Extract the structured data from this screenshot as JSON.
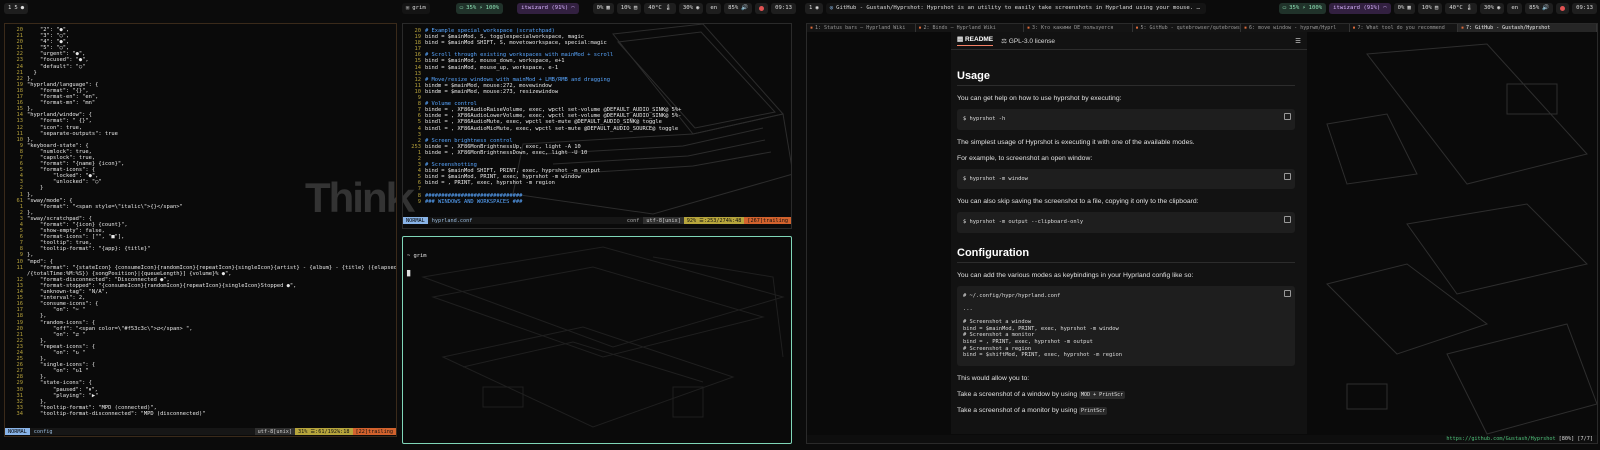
{
  "bar_left": {
    "workspace_badge": "1",
    "workspace_items": [
      "5",
      "●"
    ],
    "app_label": "grim",
    "tiles": [
      {
        "icon": "battery-icon",
        "text": "35%"
      },
      {
        "icon": "bolt-icon",
        "text": "100%"
      },
      {
        "icon": "wifi-icon",
        "text": "itwizard (91%)"
      },
      {
        "icon": "cpu-icon",
        "text": "0%"
      },
      {
        "icon": "memory-icon",
        "text": "10%"
      },
      {
        "icon": "temperature-icon",
        "text": "40°C"
      },
      {
        "icon": "disk-icon",
        "text": "30%"
      },
      {
        "icon": "keyboard-icon",
        "text": "en"
      },
      {
        "icon": "volume-icon",
        "text": "85%"
      },
      {
        "icon": "clock-icon",
        "text": "09:13"
      }
    ]
  },
  "bar_right": {
    "workspace_badge": "1",
    "window_title": "GitHub - Gustash/Hyprshot: Hyprshot is an utility to easily take screenshots in Hyprland using your mouse. - qutebrowser",
    "tiles": [
      {
        "icon": "battery-icon",
        "text": "35%"
      },
      {
        "icon": "bolt-icon",
        "text": "100%"
      },
      {
        "icon": "wifi-icon",
        "text": "itwizard (91%)"
      },
      {
        "icon": "cpu-icon",
        "text": "0%"
      },
      {
        "icon": "memory-icon",
        "text": "10%"
      },
      {
        "icon": "temperature-icon",
        "text": "40°C"
      },
      {
        "icon": "disk-icon",
        "text": "30%"
      },
      {
        "icon": "keyboard-icon",
        "text": "en"
      },
      {
        "icon": "volume-icon",
        "text": "85%"
      },
      {
        "icon": "clock-icon",
        "text": "09:13"
      }
    ]
  },
  "watermark": "Think",
  "editor_left": {
    "lines": [
      {
        "n": "20",
        "t": "    \"2\": \"●\","
      },
      {
        "n": "21",
        "t": "    \"3\": \"○\","
      },
      {
        "n": "20",
        "t": "    \"4\": \"●\","
      },
      {
        "n": "21",
        "t": "    \"5\": \"○\","
      },
      {
        "n": "22",
        "t": "    \"urgent\": \"●\","
      },
      {
        "n": "23",
        "t": "    \"focused\": \"●\","
      },
      {
        "n": "24",
        "t": "    \"default\": \"○\""
      },
      {
        "n": "21",
        "t": "  }"
      },
      {
        "n": "22",
        "t": "},"
      },
      {
        "n": "19",
        "t": "\"hyprland/language\": {"
      },
      {
        "n": "18",
        "t": "    \"format\": \"{}\","
      },
      {
        "n": "17",
        "t": "    \"format-en\": \"en\","
      },
      {
        "n": "16",
        "t": "    \"format-mn\": \"mn\""
      },
      {
        "n": "15",
        "t": "},"
      },
      {
        "n": "14",
        "t": "\"hyprland/window\": {"
      },
      {
        "n": "13",
        "t": "    \"format\": \" {}\","
      },
      {
        "n": "12",
        "t": "    \"icon\": true,"
      },
      {
        "n": "11",
        "t": "    \"separate-outputs\": true"
      },
      {
        "n": "10",
        "t": "},"
      },
      {
        "n": "9",
        "t": "\"keyboard-state\": {"
      },
      {
        "n": "8",
        "t": "    \"numlock\": true,"
      },
      {
        "n": "7",
        "t": "    \"capslock\": true,"
      },
      {
        "n": "6",
        "t": "    \"format\": \"{name} {icon}\","
      },
      {
        "n": "5",
        "t": "    \"format-icons\": {"
      },
      {
        "n": "4",
        "t": "        \"locked\": \"●\","
      },
      {
        "n": "3",
        "t": "        \"unlocked\": \"○\""
      },
      {
        "n": "2",
        "t": "    }"
      },
      {
        "n": "1",
        "t": "},"
      },
      {
        "n": "61",
        "t": "\"sway/mode\": {"
      },
      {
        "n": "1",
        "t": "    \"format\": \"<span style=\\\"italic\\\">{}</span>\""
      },
      {
        "n": "2",
        "t": "},"
      },
      {
        "n": "3",
        "t": "\"sway/scratchpad\": {"
      },
      {
        "n": "4",
        "t": "    \"format\": \"{icon} {count}\","
      },
      {
        "n": "5",
        "t": "    \"show-empty\": false,"
      },
      {
        "n": "6",
        "t": "    \"format-icons\": [\"\", \"■\"],"
      },
      {
        "n": "7",
        "t": "    \"tooltip\": true,"
      },
      {
        "n": "8",
        "t": "    \"tooltip-format\": \"{app}: {title}\""
      },
      {
        "n": "9",
        "t": "},"
      },
      {
        "n": "10",
        "t": "\"mpd\": {"
      },
      {
        "n": "11",
        "t": "    \"format\": \"{stateIcon} {consumeIcon}{randomIcon}{repeatIcon}{singleIcon}{artist} - {album} - {title} ({elapsedTime:%M:%S}"
      },
      {
        "n": "",
        "t": "/{totalTime:%M:%S}) {songPosition}|{queueLength}] {volume}% ●\","
      },
      {
        "n": "12",
        "t": "    \"format-disconnected\": \"Disconnected ●\","
      },
      {
        "n": "13",
        "t": "    \"format-stopped\": \"{consumeIcon}{randomIcon}{repeatIcon}{singleIcon}Stopped ●\","
      },
      {
        "n": "14",
        "t": "    \"unknown-tag\": \"N/A\","
      },
      {
        "n": "15",
        "t": "    \"interval\": 2,"
      },
      {
        "n": "16",
        "t": "    \"consume-icons\": {"
      },
      {
        "n": "17",
        "t": "        \"on\": \"✂ \""
      },
      {
        "n": "18",
        "t": "    },"
      },
      {
        "n": "19",
        "t": "    \"random-icons\": {"
      },
      {
        "n": "20",
        "t": "        \"off\": \"<span color=\\\"#f53c3c\\\">⇄</span> \","
      },
      {
        "n": "21",
        "t": "        \"on\": \"⇄ \""
      },
      {
        "n": "22",
        "t": "    },"
      },
      {
        "n": "23",
        "t": "    \"repeat-icons\": {"
      },
      {
        "n": "24",
        "t": "        \"on\": \"↻ \""
      },
      {
        "n": "25",
        "t": "    },"
      },
      {
        "n": "26",
        "t": "    \"single-icons\": {"
      },
      {
        "n": "27",
        "t": "        \"on\": \"↻1 \""
      },
      {
        "n": "28",
        "t": "    },"
      },
      {
        "n": "29",
        "t": "    \"state-icons\": {"
      },
      {
        "n": "30",
        "t": "        \"paused\": \"⏸\","
      },
      {
        "n": "31",
        "t": "        \"playing\": \"▶\""
      },
      {
        "n": "32",
        "t": "    },"
      },
      {
        "n": "33",
        "t": "    \"tooltip-format\": \"MPD (connected)\","
      },
      {
        "n": "34",
        "t": "    \"tooltip-format-disconnected\": \"MPD (disconnected)\""
      }
    ],
    "status": {
      "mode": "NORMAL",
      "file": "config",
      "encoding": "utf-8[unix]",
      "position": "31% ☰:61/192℅:18",
      "trailing": "[22]trailing"
    }
  },
  "editor_top": {
    "lines": [
      {
        "n": "20",
        "t": "# Example special workspace (scratchpad)",
        "k": "c"
      },
      {
        "n": "19",
        "t": "bind = $mainMod, S, togglespecialworkspace, magic"
      },
      {
        "n": "18",
        "t": "bind = $mainMod SHIFT, S, movetoworkspace, special:magic"
      },
      {
        "n": "17",
        "t": ""
      },
      {
        "n": "16",
        "t": "# Scroll through existing workspaces with mainMod + scroll",
        "k": "c"
      },
      {
        "n": "15",
        "t": "bind = $mainMod, mouse_down, workspace, e+1"
      },
      {
        "n": "14",
        "t": "bind = $mainMod, mouse_up, workspace, e-1"
      },
      {
        "n": "13",
        "t": ""
      },
      {
        "n": "12",
        "t": "# Move/resize windows with mainMod + LMB/RMB and dragging",
        "k": "c"
      },
      {
        "n": "11",
        "t": "bindm = $mainMod, mouse:272, movewindow"
      },
      {
        "n": "10",
        "t": "bindm = $mainMod, mouse:273, resizewindow"
      },
      {
        "n": "9",
        "t": ""
      },
      {
        "n": "8",
        "t": "# Volume control",
        "k": "c"
      },
      {
        "n": "7",
        "t": "binde = , XF86AudioRaiseVolume, exec, wpctl set-volume @DEFAULT_AUDIO_SINK@ 5%+"
      },
      {
        "n": "6",
        "t": "binde = , XF86AudioLowerVolume, exec, wpctl set-volume @DEFAULT_AUDIO_SINK@ 5%-"
      },
      {
        "n": "5",
        "t": "bindl = , XF86AudioMute, exec, wpctl set-mute @DEFAULT_AUDIO_SINK@ toggle"
      },
      {
        "n": "4",
        "t": "bindl = , XF86AudioMicMute, exec, wpctl set-mute @DEFAULT_AUDIO_SOURCE@ toggle"
      },
      {
        "n": "3",
        "t": ""
      },
      {
        "n": "2",
        "t": "# Screen brightness control",
        "k": "c"
      },
      {
        "n": "253",
        "t": "binde = , XF86MonBrightnessUp, exec, light -A 10"
      },
      {
        "n": "1",
        "t": "binde = , XF86MonBrightnessDown, exec, light -U 10"
      },
      {
        "n": "2",
        "t": ""
      },
      {
        "n": "3",
        "t": "# Screenshotting",
        "k": "c"
      },
      {
        "n": "4",
        "t": "bind = $mainMod SHIFT, PRINT, exec, hyprshot -m output"
      },
      {
        "n": "5",
        "t": "bind = $mainMod, PRINT, exec, hyprshot -m window"
      },
      {
        "n": "6",
        "t": "bind = , PRINT, exec, hyprshot -m region"
      },
      {
        "n": "7",
        "t": ""
      },
      {
        "n": "8",
        "t": "##############################",
        "k": "c"
      },
      {
        "n": "9",
        "t": "### WINDOWS AND WORKSPACES ###",
        "k": "c"
      }
    ],
    "status": {
      "mode": "NORMAL",
      "file": "hyprland.conf",
      "filetype": "conf",
      "encoding": "utf-8[unix]",
      "position": "92% ☰:253/274℅:48",
      "trailing": "[267]trailing"
    }
  },
  "terminal": {
    "prompt": "~ grim",
    "cursor": "█"
  },
  "browser": {
    "tabs": [
      "1: Status bars — Hyprland Wiki",
      "2: Binds – Hyprland Wiki",
      "3: Кто какими DE пользуется",
      "5: GitHub - qutebrowser/qutebrowser",
      "6: move window - hyprwm/Hyprl",
      "7: What tool do you recommend",
      "7: GitHub - Gustash/Hyprshot"
    ],
    "readme_tabs": {
      "readme": "README",
      "license": "GPL-3.0 license"
    },
    "sections": {
      "usage_title": "Usage",
      "usage_p1": "You can get help on how to use hyprshot by executing:",
      "code1": "$ hyprshot -h",
      "usage_p2": "The simplest usage of Hyprshot is executing it with one of the available modes.",
      "usage_p3": "For example, to screenshot an open window:",
      "code2": "$ hyprshot -m window",
      "usage_p4": "You can also skip saving the screenshot to a file, copying it only to the clipboard:",
      "code3": "$ hyprshot -m output --clipboard-only",
      "config_title": "Configuration",
      "config_p1": "You can add the various modes as keybindings in your Hyprland config like so:",
      "code4": "# ~/.config/hypr/hyprland.conf\n\n...\n\n# Screenshot a window\nbind = $mainMod, PRINT, exec, hyprshot -m window\n# Screenshot a monitor\nbind = , PRINT, exec, hyprshot -m output\n# Screenshot a region\nbind = $shiftMod, PRINT, exec, hyprshot -m region",
      "config_p2": "This would allow you to:",
      "config_p3_pre": "Take a screenshot of a window by using",
      "config_p3_code": "MOD + PrintScr",
      "config_p4_pre": "Take a screenshot of a monitor by using",
      "config_p4_code": "PrintScr"
    },
    "url": "https://github.com/Gustash/Hyprshot",
    "url_status": "[80%] [7/7]"
  },
  "colors": {
    "accent_green": "#4ec27a",
    "focus_border": "#7fd6b8",
    "line_number": "#b5a13b"
  }
}
